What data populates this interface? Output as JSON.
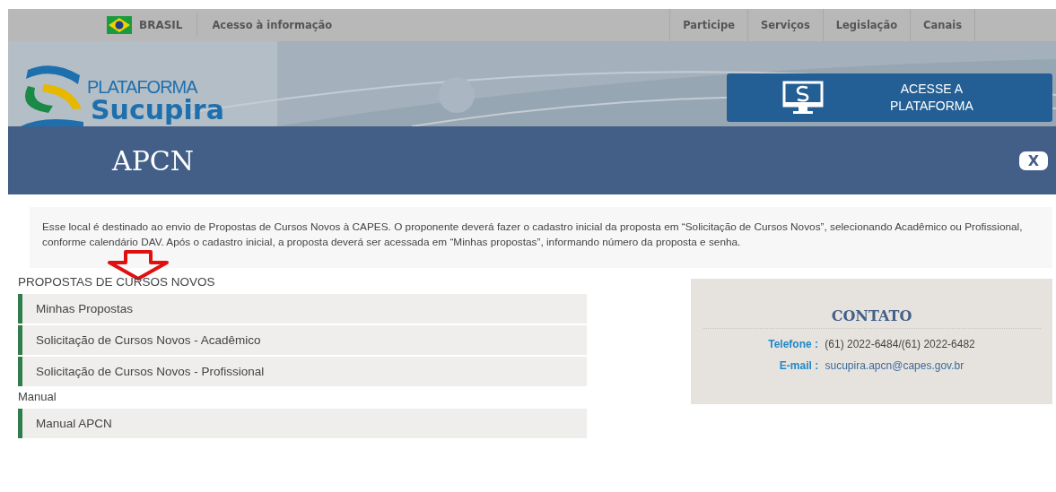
{
  "gov_bar": {
    "country": "BRASIL",
    "access_link": "Acesso à informação",
    "menu": [
      "Participe",
      "Serviços",
      "Legislação",
      "Canais"
    ]
  },
  "banner": {
    "logo_small": "PLATAFORMA",
    "logo_large": "Sucupira",
    "access_button": [
      "ACESSE A",
      "PLATAFORMA"
    ]
  },
  "page_header": {
    "title": "APCN",
    "close": "X"
  },
  "intro": "Esse local é destinado ao envio de Propostas de Cursos Novos à CAPES. O proponente deverá fazer o cadastro inicial da proposta em “Solicitação de Cursos Novos”, selecionando Acadêmico ou Profissional, conforme calendário DAV. Após o cadastro inicial, a proposta deverá ser acessada em “Minhas propostas”, informando número da proposta e senha.",
  "sections": [
    {
      "title": "PROPOSTAS DE CURSOS NOVOS",
      "links": [
        "Minhas Propostas",
        "Solicitação de Cursos Novos - Acadêmico",
        "Solicitação de Cursos Novos - Profissional"
      ]
    },
    {
      "title": "Manual",
      "links": [
        "Manual APCN"
      ]
    }
  ],
  "contact": {
    "title": "CONTATO",
    "rows": [
      {
        "label": "Telefone :",
        "value": "(61) 2022-6484/(61) 2022-6482",
        "kind": "text"
      },
      {
        "label": "E-mail :",
        "value": "sucupira.apcn@capes.gov.br",
        "kind": "link"
      }
    ]
  }
}
